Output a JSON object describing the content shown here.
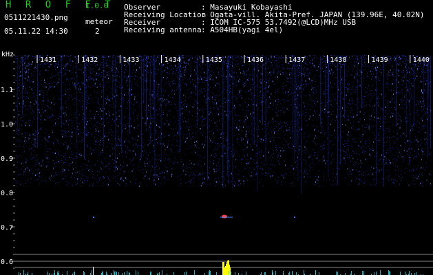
{
  "header": {
    "app_title": "H R O F F T",
    "app_version": "1.0.0",
    "file_name": "0511221430.png",
    "datetime": "05.11.22 14:30",
    "meteor_label": "meteor",
    "meteor_count": "2"
  },
  "info": [
    {
      "label": "Observer",
      "value": ": Masayuki Kobayashi"
    },
    {
      "label": "Receiving Location",
      "value": ": Ogata-vill. Akita-Pref. JAPAN (139.96E, 40.02N)"
    },
    {
      "label": "Receiver",
      "value": ": ICOM IC-575 53.7492(@LCD)MHz USB"
    },
    {
      "label": "Receiving antenna",
      "value": ": A504HB(yagi 4el)"
    }
  ],
  "axis": {
    "unit": "kHz",
    "y_ticks": [
      "1.1",
      "1.0",
      "0.9",
      "0.8",
      "0.7",
      "0.6"
    ],
    "time_labels": [
      "1431",
      "1432",
      "1433",
      "1434",
      "1435",
      "1436",
      "1437",
      "1438",
      "1439",
      "1440"
    ]
  },
  "colors": {
    "background": "#000000",
    "noise": "#2233dd",
    "text_green": "#22cc22",
    "meteor_echo": "#ffff00"
  }
}
